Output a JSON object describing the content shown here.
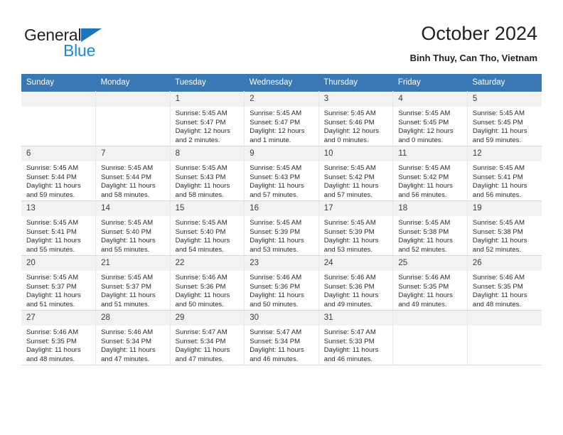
{
  "brand": {
    "name_part1": "General",
    "name_part2": "Blue",
    "triangle_icon": "blue-triangle-icon",
    "colors": {
      "dark": "#231f20",
      "blue": "#1b8bd0",
      "triangle": "#1b76bd"
    }
  },
  "header": {
    "title": "October 2024",
    "subtitle": "Binh Thuy, Can Tho, Vietnam"
  },
  "theme": {
    "header_blue": "#3a78b5",
    "daynum_bg": "#f2f2f2",
    "grid_line": "#e8e8e8"
  },
  "calendar": {
    "weekdays": [
      "Sunday",
      "Monday",
      "Tuesday",
      "Wednesday",
      "Thursday",
      "Friday",
      "Saturday"
    ],
    "weeks": [
      [
        {
          "day": "",
          "sunrise": "",
          "sunset": "",
          "daylight_line1": "",
          "daylight_line2": ""
        },
        {
          "day": "",
          "sunrise": "",
          "sunset": "",
          "daylight_line1": "",
          "daylight_line2": ""
        },
        {
          "day": "1",
          "sunrise": "Sunrise: 5:45 AM",
          "sunset": "Sunset: 5:47 PM",
          "daylight_line1": "Daylight: 12 hours",
          "daylight_line2": "and 2 minutes."
        },
        {
          "day": "2",
          "sunrise": "Sunrise: 5:45 AM",
          "sunset": "Sunset: 5:47 PM",
          "daylight_line1": "Daylight: 12 hours",
          "daylight_line2": "and 1 minute."
        },
        {
          "day": "3",
          "sunrise": "Sunrise: 5:45 AM",
          "sunset": "Sunset: 5:46 PM",
          "daylight_line1": "Daylight: 12 hours",
          "daylight_line2": "and 0 minutes."
        },
        {
          "day": "4",
          "sunrise": "Sunrise: 5:45 AM",
          "sunset": "Sunset: 5:45 PM",
          "daylight_line1": "Daylight: 12 hours",
          "daylight_line2": "and 0 minutes."
        },
        {
          "day": "5",
          "sunrise": "Sunrise: 5:45 AM",
          "sunset": "Sunset: 5:45 PM",
          "daylight_line1": "Daylight: 11 hours",
          "daylight_line2": "and 59 minutes."
        }
      ],
      [
        {
          "day": "6",
          "sunrise": "Sunrise: 5:45 AM",
          "sunset": "Sunset: 5:44 PM",
          "daylight_line1": "Daylight: 11 hours",
          "daylight_line2": "and 59 minutes."
        },
        {
          "day": "7",
          "sunrise": "Sunrise: 5:45 AM",
          "sunset": "Sunset: 5:44 PM",
          "daylight_line1": "Daylight: 11 hours",
          "daylight_line2": "and 58 minutes."
        },
        {
          "day": "8",
          "sunrise": "Sunrise: 5:45 AM",
          "sunset": "Sunset: 5:43 PM",
          "daylight_line1": "Daylight: 11 hours",
          "daylight_line2": "and 58 minutes."
        },
        {
          "day": "9",
          "sunrise": "Sunrise: 5:45 AM",
          "sunset": "Sunset: 5:43 PM",
          "daylight_line1": "Daylight: 11 hours",
          "daylight_line2": "and 57 minutes."
        },
        {
          "day": "10",
          "sunrise": "Sunrise: 5:45 AM",
          "sunset": "Sunset: 5:42 PM",
          "daylight_line1": "Daylight: 11 hours",
          "daylight_line2": "and 57 minutes."
        },
        {
          "day": "11",
          "sunrise": "Sunrise: 5:45 AM",
          "sunset": "Sunset: 5:42 PM",
          "daylight_line1": "Daylight: 11 hours",
          "daylight_line2": "and 56 minutes."
        },
        {
          "day": "12",
          "sunrise": "Sunrise: 5:45 AM",
          "sunset": "Sunset: 5:41 PM",
          "daylight_line1": "Daylight: 11 hours",
          "daylight_line2": "and 56 minutes."
        }
      ],
      [
        {
          "day": "13",
          "sunrise": "Sunrise: 5:45 AM",
          "sunset": "Sunset: 5:41 PM",
          "daylight_line1": "Daylight: 11 hours",
          "daylight_line2": "and 55 minutes."
        },
        {
          "day": "14",
          "sunrise": "Sunrise: 5:45 AM",
          "sunset": "Sunset: 5:40 PM",
          "daylight_line1": "Daylight: 11 hours",
          "daylight_line2": "and 55 minutes."
        },
        {
          "day": "15",
          "sunrise": "Sunrise: 5:45 AM",
          "sunset": "Sunset: 5:40 PM",
          "daylight_line1": "Daylight: 11 hours",
          "daylight_line2": "and 54 minutes."
        },
        {
          "day": "16",
          "sunrise": "Sunrise: 5:45 AM",
          "sunset": "Sunset: 5:39 PM",
          "daylight_line1": "Daylight: 11 hours",
          "daylight_line2": "and 53 minutes."
        },
        {
          "day": "17",
          "sunrise": "Sunrise: 5:45 AM",
          "sunset": "Sunset: 5:39 PM",
          "daylight_line1": "Daylight: 11 hours",
          "daylight_line2": "and 53 minutes."
        },
        {
          "day": "18",
          "sunrise": "Sunrise: 5:45 AM",
          "sunset": "Sunset: 5:38 PM",
          "daylight_line1": "Daylight: 11 hours",
          "daylight_line2": "and 52 minutes."
        },
        {
          "day": "19",
          "sunrise": "Sunrise: 5:45 AM",
          "sunset": "Sunset: 5:38 PM",
          "daylight_line1": "Daylight: 11 hours",
          "daylight_line2": "and 52 minutes."
        }
      ],
      [
        {
          "day": "20",
          "sunrise": "Sunrise: 5:45 AM",
          "sunset": "Sunset: 5:37 PM",
          "daylight_line1": "Daylight: 11 hours",
          "daylight_line2": "and 51 minutes."
        },
        {
          "day": "21",
          "sunrise": "Sunrise: 5:45 AM",
          "sunset": "Sunset: 5:37 PM",
          "daylight_line1": "Daylight: 11 hours",
          "daylight_line2": "and 51 minutes."
        },
        {
          "day": "22",
          "sunrise": "Sunrise: 5:46 AM",
          "sunset": "Sunset: 5:36 PM",
          "daylight_line1": "Daylight: 11 hours",
          "daylight_line2": "and 50 minutes."
        },
        {
          "day": "23",
          "sunrise": "Sunrise: 5:46 AM",
          "sunset": "Sunset: 5:36 PM",
          "daylight_line1": "Daylight: 11 hours",
          "daylight_line2": "and 50 minutes."
        },
        {
          "day": "24",
          "sunrise": "Sunrise: 5:46 AM",
          "sunset": "Sunset: 5:36 PM",
          "daylight_line1": "Daylight: 11 hours",
          "daylight_line2": "and 49 minutes."
        },
        {
          "day": "25",
          "sunrise": "Sunrise: 5:46 AM",
          "sunset": "Sunset: 5:35 PM",
          "daylight_line1": "Daylight: 11 hours",
          "daylight_line2": "and 49 minutes."
        },
        {
          "day": "26",
          "sunrise": "Sunrise: 5:46 AM",
          "sunset": "Sunset: 5:35 PM",
          "daylight_line1": "Daylight: 11 hours",
          "daylight_line2": "and 48 minutes."
        }
      ],
      [
        {
          "day": "27",
          "sunrise": "Sunrise: 5:46 AM",
          "sunset": "Sunset: 5:35 PM",
          "daylight_line1": "Daylight: 11 hours",
          "daylight_line2": "and 48 minutes."
        },
        {
          "day": "28",
          "sunrise": "Sunrise: 5:46 AM",
          "sunset": "Sunset: 5:34 PM",
          "daylight_line1": "Daylight: 11 hours",
          "daylight_line2": "and 47 minutes."
        },
        {
          "day": "29",
          "sunrise": "Sunrise: 5:47 AM",
          "sunset": "Sunset: 5:34 PM",
          "daylight_line1": "Daylight: 11 hours",
          "daylight_line2": "and 47 minutes."
        },
        {
          "day": "30",
          "sunrise": "Sunrise: 5:47 AM",
          "sunset": "Sunset: 5:34 PM",
          "daylight_line1": "Daylight: 11 hours",
          "daylight_line2": "and 46 minutes."
        },
        {
          "day": "31",
          "sunrise": "Sunrise: 5:47 AM",
          "sunset": "Sunset: 5:33 PM",
          "daylight_line1": "Daylight: 11 hours",
          "daylight_line2": "and 46 minutes."
        },
        {
          "day": "",
          "sunrise": "",
          "sunset": "",
          "daylight_line1": "",
          "daylight_line2": ""
        },
        {
          "day": "",
          "sunrise": "",
          "sunset": "",
          "daylight_line1": "",
          "daylight_line2": ""
        }
      ]
    ]
  }
}
